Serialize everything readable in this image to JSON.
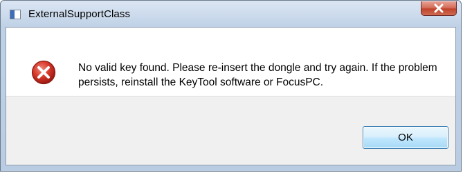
{
  "window": {
    "title": "ExternalSupportClass"
  },
  "dialog": {
    "icon": "error-icon",
    "message": "No valid key found. Please re-insert the dongle and try again. If the problem persists, reinstall the KeyTool software or FocusPC.",
    "ok_label": "OK"
  },
  "colors": {
    "close_button": "#c7503a",
    "error_icon": "#c42b1c",
    "ok_border": "#3c7fb1"
  }
}
